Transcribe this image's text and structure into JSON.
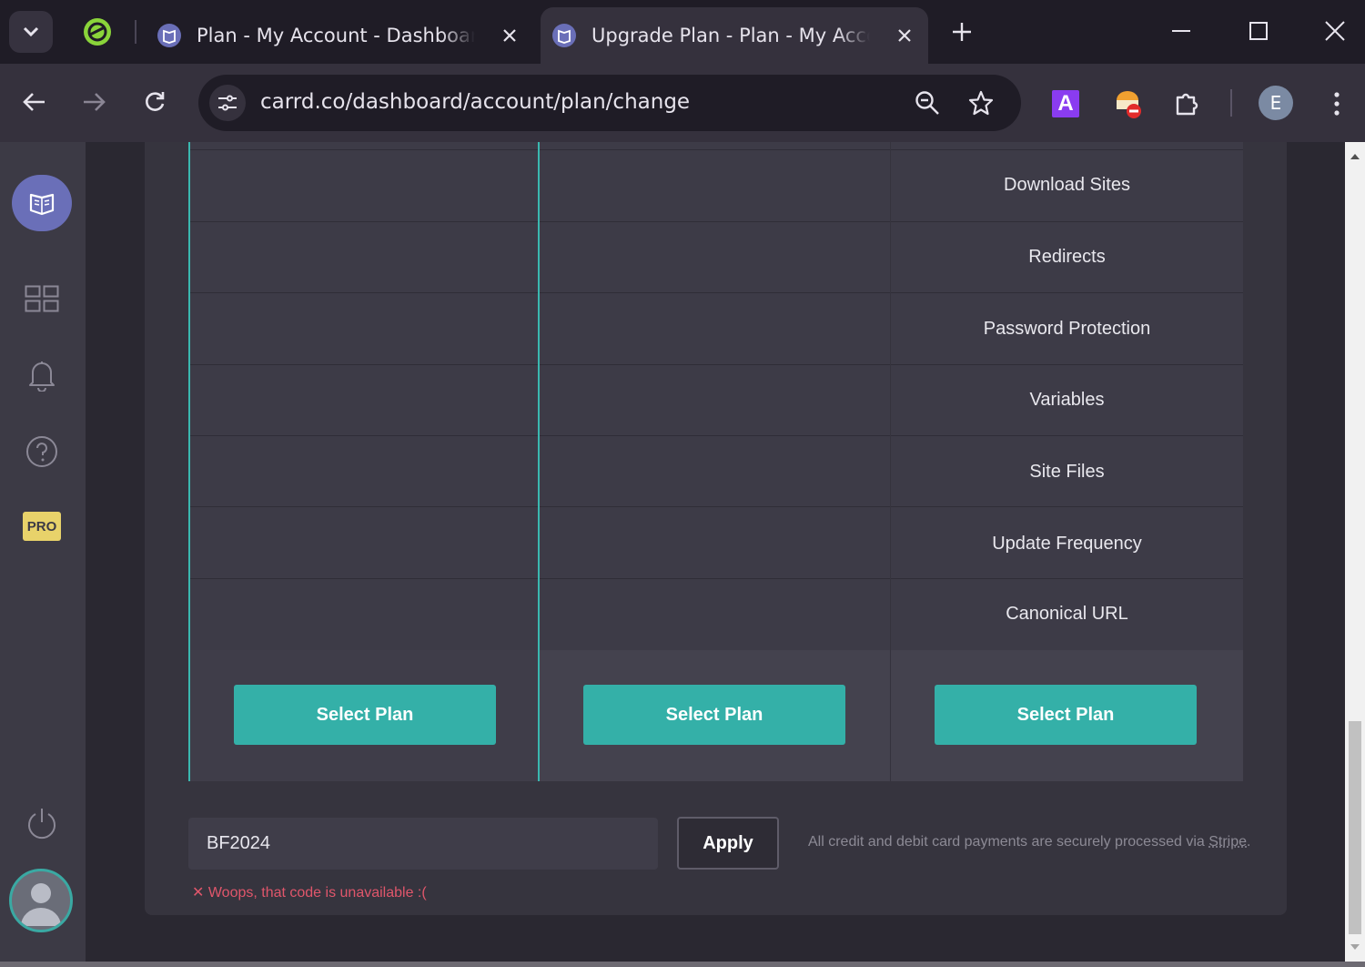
{
  "browser": {
    "tabs": [
      {
        "title": "Plan - My Account - Dashboard",
        "active": false
      },
      {
        "title": "Upgrade Plan - Plan - My Account",
        "active": true
      }
    ],
    "url": "carrd.co/dashboard/account/plan/change",
    "profile_initial": "E",
    "extension_badge": "A"
  },
  "sidebar": {
    "items": [
      {
        "name": "sites",
        "icon": "grid-icon"
      },
      {
        "name": "notifications",
        "icon": "bell-icon"
      },
      {
        "name": "help",
        "icon": "question-icon"
      }
    ],
    "pro_label": "PRO"
  },
  "plans": {
    "features": [
      "Download Sites",
      "Redirects",
      "Password Protection",
      "Variables",
      "Site Files",
      "Update Frequency",
      "Canonical URL"
    ],
    "select_label": "Select Plan"
  },
  "coupon": {
    "value": "BF2024",
    "apply_label": "Apply",
    "error": "✕ Woops, that code is unavailable :(",
    "secure_text": "All credit and debit card payments are securely processed via ",
    "stripe_link": "Stripe",
    "secure_end": "."
  },
  "colors": {
    "accent": "#34b0a8",
    "selected_border": "#3ab8b0",
    "error": "#e0566b",
    "pro_badge": "#e8d26a"
  }
}
